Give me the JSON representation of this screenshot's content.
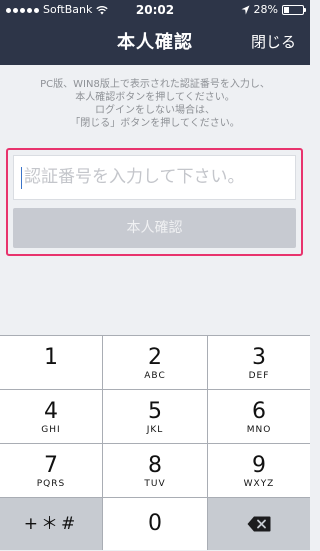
{
  "status_bar": {
    "carrier": "SoftBank",
    "time": "20:02",
    "battery_percent": "28%",
    "battery_level": 0.28
  },
  "nav": {
    "title": "本人確認",
    "close_label": "閉じる"
  },
  "instructions": "PC版、WIN8版上で表示された認証番号を入力し、\n本人確認ボタンを押してください。\nログインをしない場合は、\n「閉じる」ボタンを押してください。",
  "form": {
    "code_placeholder": "認証番号を入力して下さい。",
    "confirm_label": "本人確認"
  },
  "keypad": {
    "keys": [
      {
        "num": "1",
        "letters": ""
      },
      {
        "num": "2",
        "letters": "ABC"
      },
      {
        "num": "3",
        "letters": "DEF"
      },
      {
        "num": "4",
        "letters": "GHI"
      },
      {
        "num": "5",
        "letters": "JKL"
      },
      {
        "num": "6",
        "letters": "MNO"
      },
      {
        "num": "7",
        "letters": "PQRS"
      },
      {
        "num": "8",
        "letters": "TUV"
      },
      {
        "num": "9",
        "letters": "WXYZ"
      }
    ],
    "symbols_label": "+＊#",
    "zero": "0",
    "backspace_icon": "backspace-icon"
  }
}
